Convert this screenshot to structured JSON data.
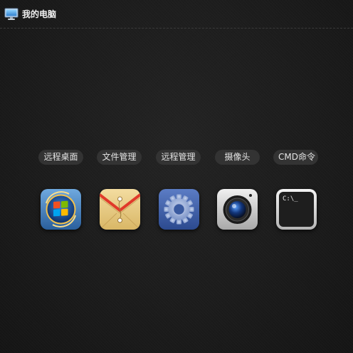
{
  "window": {
    "title": "我的电脑",
    "icon": "computer-monitor-icon"
  },
  "apps": [
    {
      "label": "远程桌面",
      "icon": "windows-logo-icon"
    },
    {
      "label": "文件管理",
      "icon": "file-envelope-icon"
    },
    {
      "label": "远程管理",
      "icon": "gear-icon"
    },
    {
      "label": "摄像头",
      "icon": "camera-icon"
    },
    {
      "label": "CMD命令",
      "icon": "terminal-icon",
      "terminal_text": "C:\\_"
    }
  ],
  "colors": {
    "background": "#1b1b1b",
    "pill": "#333333",
    "text": "#e4e4e4"
  }
}
